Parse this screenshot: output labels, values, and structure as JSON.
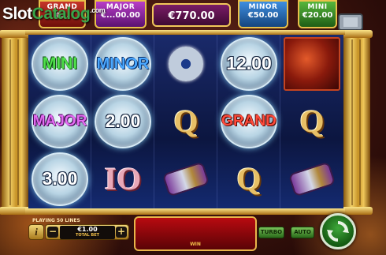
{
  "brand": {
    "logo_text_1": "Slot",
    "logo_text_2": "Catalog",
    "logo_suffix": ".com"
  },
  "jackpots": {
    "grand": {
      "label": "GRAND",
      "value": "€..."
    },
    "major": {
      "label": "MAJOR",
      "value": "€...00.00"
    },
    "mid": {
      "value": "€770.00"
    },
    "minor": {
      "label": "MINOR",
      "value": "€50.00"
    },
    "mini": {
      "label": "MINI",
      "value": "€20.00"
    }
  },
  "reels": [
    [
      {
        "type": "coin",
        "text": "MINI",
        "variant": "mini"
      },
      {
        "type": "coin",
        "text": "MAJOR",
        "variant": "major"
      },
      {
        "type": "coin",
        "text": "3.00",
        "variant": "num"
      }
    ],
    [
      {
        "type": "coin",
        "text": "MINOR",
        "variant": "minor"
      },
      {
        "type": "coin",
        "text": "2.00",
        "variant": "num"
      },
      {
        "type": "letter",
        "text": "IO",
        "variant": "io"
      }
    ],
    [
      {
        "type": "icon",
        "icon": "ring-icon"
      },
      {
        "type": "letter",
        "text": "Q",
        "variant": "q"
      },
      {
        "type": "icon",
        "icon": "gauntlet-icon"
      }
    ],
    [
      {
        "type": "coin",
        "text": "12.00",
        "variant": "num"
      },
      {
        "type": "coin",
        "text": "GRAND",
        "variant": "grand"
      },
      {
        "type": "letter",
        "text": "Q",
        "variant": "q"
      }
    ],
    [
      {
        "type": "icon",
        "icon": "lava-block-icon"
      },
      {
        "type": "letter",
        "text": "Q",
        "variant": "q"
      },
      {
        "type": "icon",
        "icon": "gauntlet-icon"
      }
    ]
  ],
  "controls": {
    "lines_label": "PLAYING 50 LINES",
    "info_label": "i",
    "bet_minus": "−",
    "bet_plus": "+",
    "bet_value": "€1.00",
    "bet_label": "TOTAL BET",
    "win_label": "WIN",
    "turbo_label": "TURBO",
    "auto_label": "AUTO"
  },
  "icons": [
    "hammer-icon",
    "spin-icon",
    "ring-icon",
    "gauntlet-icon",
    "lava-block-icon"
  ],
  "colors": {
    "gold": "#e8c04a",
    "grand": "#c6352a",
    "major": "#b83dc8",
    "minor": "#3e8ee0",
    "mini": "#56b63c",
    "win_panel": "#b80a10",
    "spin": "#3ea83a"
  }
}
